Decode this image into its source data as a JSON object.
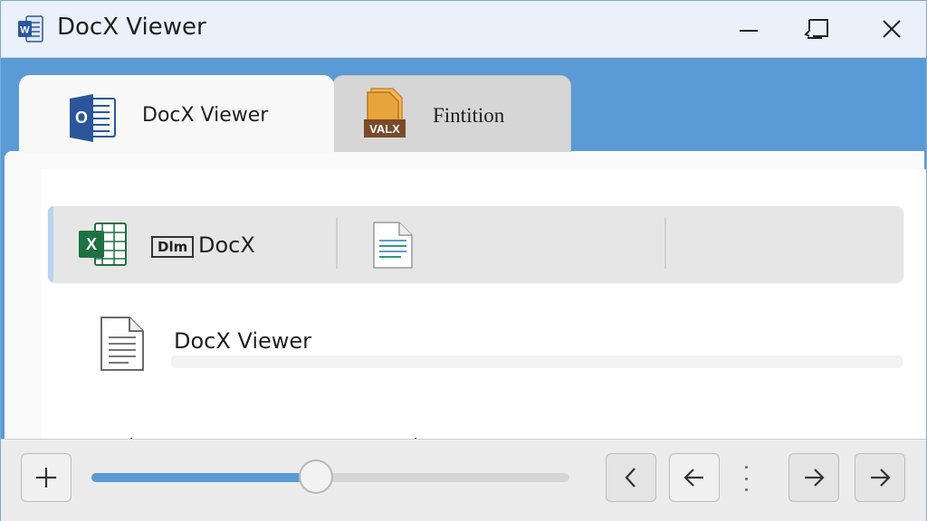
{
  "window": {
    "title": "DocX Viewer",
    "app_icon": "word-icon"
  },
  "window_controls": {
    "minimize": "minimize-icon",
    "restore": "restore-icon",
    "close": "close-icon"
  },
  "tabs": [
    {
      "label": "DocX Viewer",
      "icon": "outlook-icon",
      "active": true
    },
    {
      "label": "Fintition",
      "icon": "archive-icon",
      "icon_text": "VALX",
      "active": false
    }
  ],
  "toolbar": {
    "badge": "Dlm",
    "label": "DocX",
    "icons": [
      "excel-icon",
      "document-lines-icon"
    ]
  },
  "document": {
    "label": "DocX Viewer",
    "icon": "document-icon"
  },
  "footer": {
    "zoom_level": 0.47,
    "buttons": [
      "zoom-in",
      "previous",
      "back",
      "forward",
      "next"
    ]
  },
  "colors": {
    "accent": "#5b9bd5",
    "excel": "#1e7145",
    "word": "#2b579a",
    "archive": "#e7a43c"
  }
}
